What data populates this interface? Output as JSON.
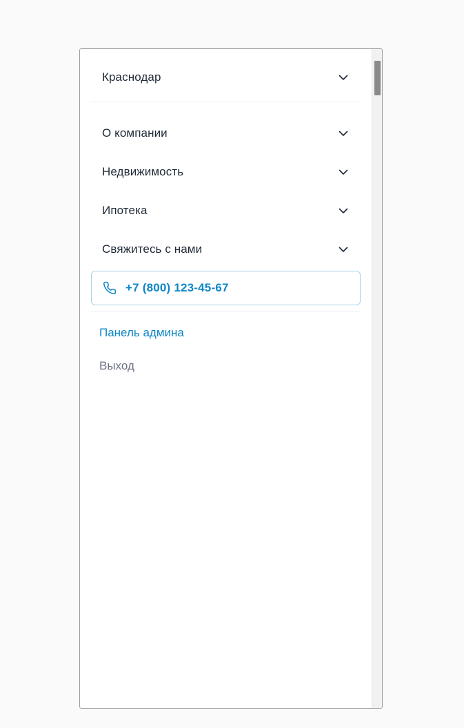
{
  "city_selector": {
    "label": "Краснодар"
  },
  "menu": {
    "items": [
      {
        "label": "О компании"
      },
      {
        "label": "Недвижимость"
      },
      {
        "label": "Ипотека"
      },
      {
        "label": "Свяжитесь с нами"
      }
    ]
  },
  "phone_button": {
    "label": "+7 (800) 123-45-67"
  },
  "links": {
    "admin_label": "Панель админа",
    "logout_label": "Выход"
  },
  "colors": {
    "accent": "#0e86c6",
    "text_primary": "#1f2937",
    "text_muted": "#6b7280",
    "phone_border": "#a9d4ea"
  },
  "icons": {
    "chevron": "chevron-down-icon",
    "phone": "phone-icon"
  }
}
